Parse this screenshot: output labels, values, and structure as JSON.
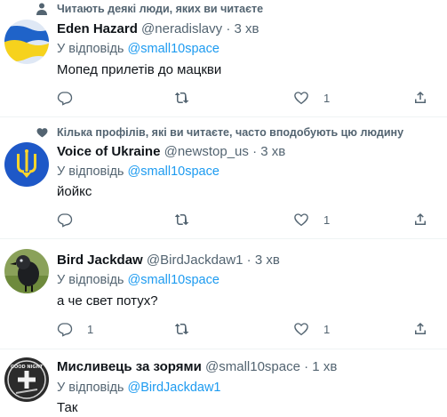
{
  "tweets": [
    {
      "social": "Читають деякі люди, яких ви читаєте",
      "social_icon": "person-icon",
      "name": "Eden Hazard",
      "handle": "@neradislavy",
      "time": "· 3 хв",
      "reply_prefix": "У відповідь",
      "reply_to": "@small10space",
      "text": "Мопед прилетів до мацкви",
      "like_count": "1",
      "avatar": "ukraine-flag"
    },
    {
      "social": "Кілька профілів, які ви читаєте, часто вподобують цю людину",
      "social_icon": "heart-icon",
      "name": "Voice of Ukraine",
      "handle": "@newstop_us",
      "time": "· 3 хв",
      "reply_prefix": "У відповідь",
      "reply_to": "@small10space",
      "text": "йойкс",
      "like_count": "1",
      "avatar": "trident"
    },
    {
      "name": "Bird Jackdaw",
      "handle": "@BirdJackdaw1",
      "time": "· 3 хв",
      "reply_prefix": "У відповідь",
      "reply_to": "@small10space",
      "text": "а че свет потух?",
      "reply_count": "1",
      "like_count": "1",
      "avatar": "jackdaw-bird"
    },
    {
      "name": "Мисливець за зорями",
      "handle": "@small10space",
      "time": "· 1 хв",
      "reply_prefix": "У відповідь",
      "reply_to": "@BirdJackdaw1",
      "text": "Так",
      "avatar": "good-night-badge",
      "avatar_text": "GOOD NIGHT"
    }
  ]
}
